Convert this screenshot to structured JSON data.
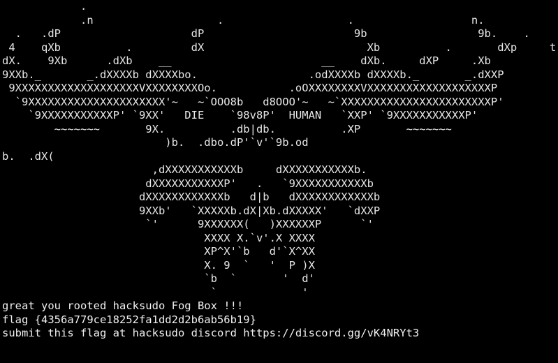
{
  "terminal": {
    "colors": {
      "background": "#000000",
      "foreground": "#e6e6e6"
    },
    "ascii_art": [
      "            .                                                                        .",
      "            .n                   .                   .                  n.",
      "  .   .dP                    dP                       9b                 9b.    .",
      " 4    qXb          .         dX                         Xb          .       dXp     t",
      "dX.    9Xb      .dXb    __                       __    dXb.     dXP     .Xb",
      "9XXb._       _.dXXXXb dXXXXbo.                 .odXXXXb dXXXXb._       _.dXXP",
      " 9XXXXXXXXXXXXXXXXXXXVXXXXXXXXOo.           .oOXXXXXXXXVXXXXXXXXXXXXXXXXXXXP",
      "  `9XXXXXXXXXXXXXXXXXXXXX'~   ~`OOO8b   d8OOO'~   ~`XXXXXXXXXXXXXXXXXXXXXXXP'",
      "    `9XXXXXXXXXXXP' `9XX'   DIE    `98v8P'  HUMAN   `XXP' `9XXXXXXXXXXXP'",
      "        ~~~~~~~       9X.          .db|db.          .XP       ~~~~~~~",
      "                         )b.  .dbo.dP'`v'`9b.od",
      "b.  .dX(",
      "                       ,dXXXXXXXXXXXb     dXXXXXXXXXXXb.",
      "                      dXXXXXXXXXXXP'   .   `9XXXXXXXXXXXb",
      "                     dXXXXXXXXXXXXb   d|b   dXXXXXXXXXXXXb",
      "                     9XXb'   `XXXXXb.dX|Xb.dXXXXX'   `dXXP",
      "                      `'      9XXXXXX(   )XXXXXXP      `'",
      "                               XXXX X.`v'.X XXXX",
      "                               XP^X'`b   d'`X^XX",
      "                               X. 9  `   '  P )X",
      "                               `b  `       '  d'",
      "                                `             '"
    ],
    "messages": [
      "great you rooted hacksudo Fog Box !!!",
      "flag {4356a779ce18252fa1dd2d2b6ab56b19}",
      "submit this flag at hacksudo discord https://discord.gg/vK4NRYt3"
    ]
  }
}
